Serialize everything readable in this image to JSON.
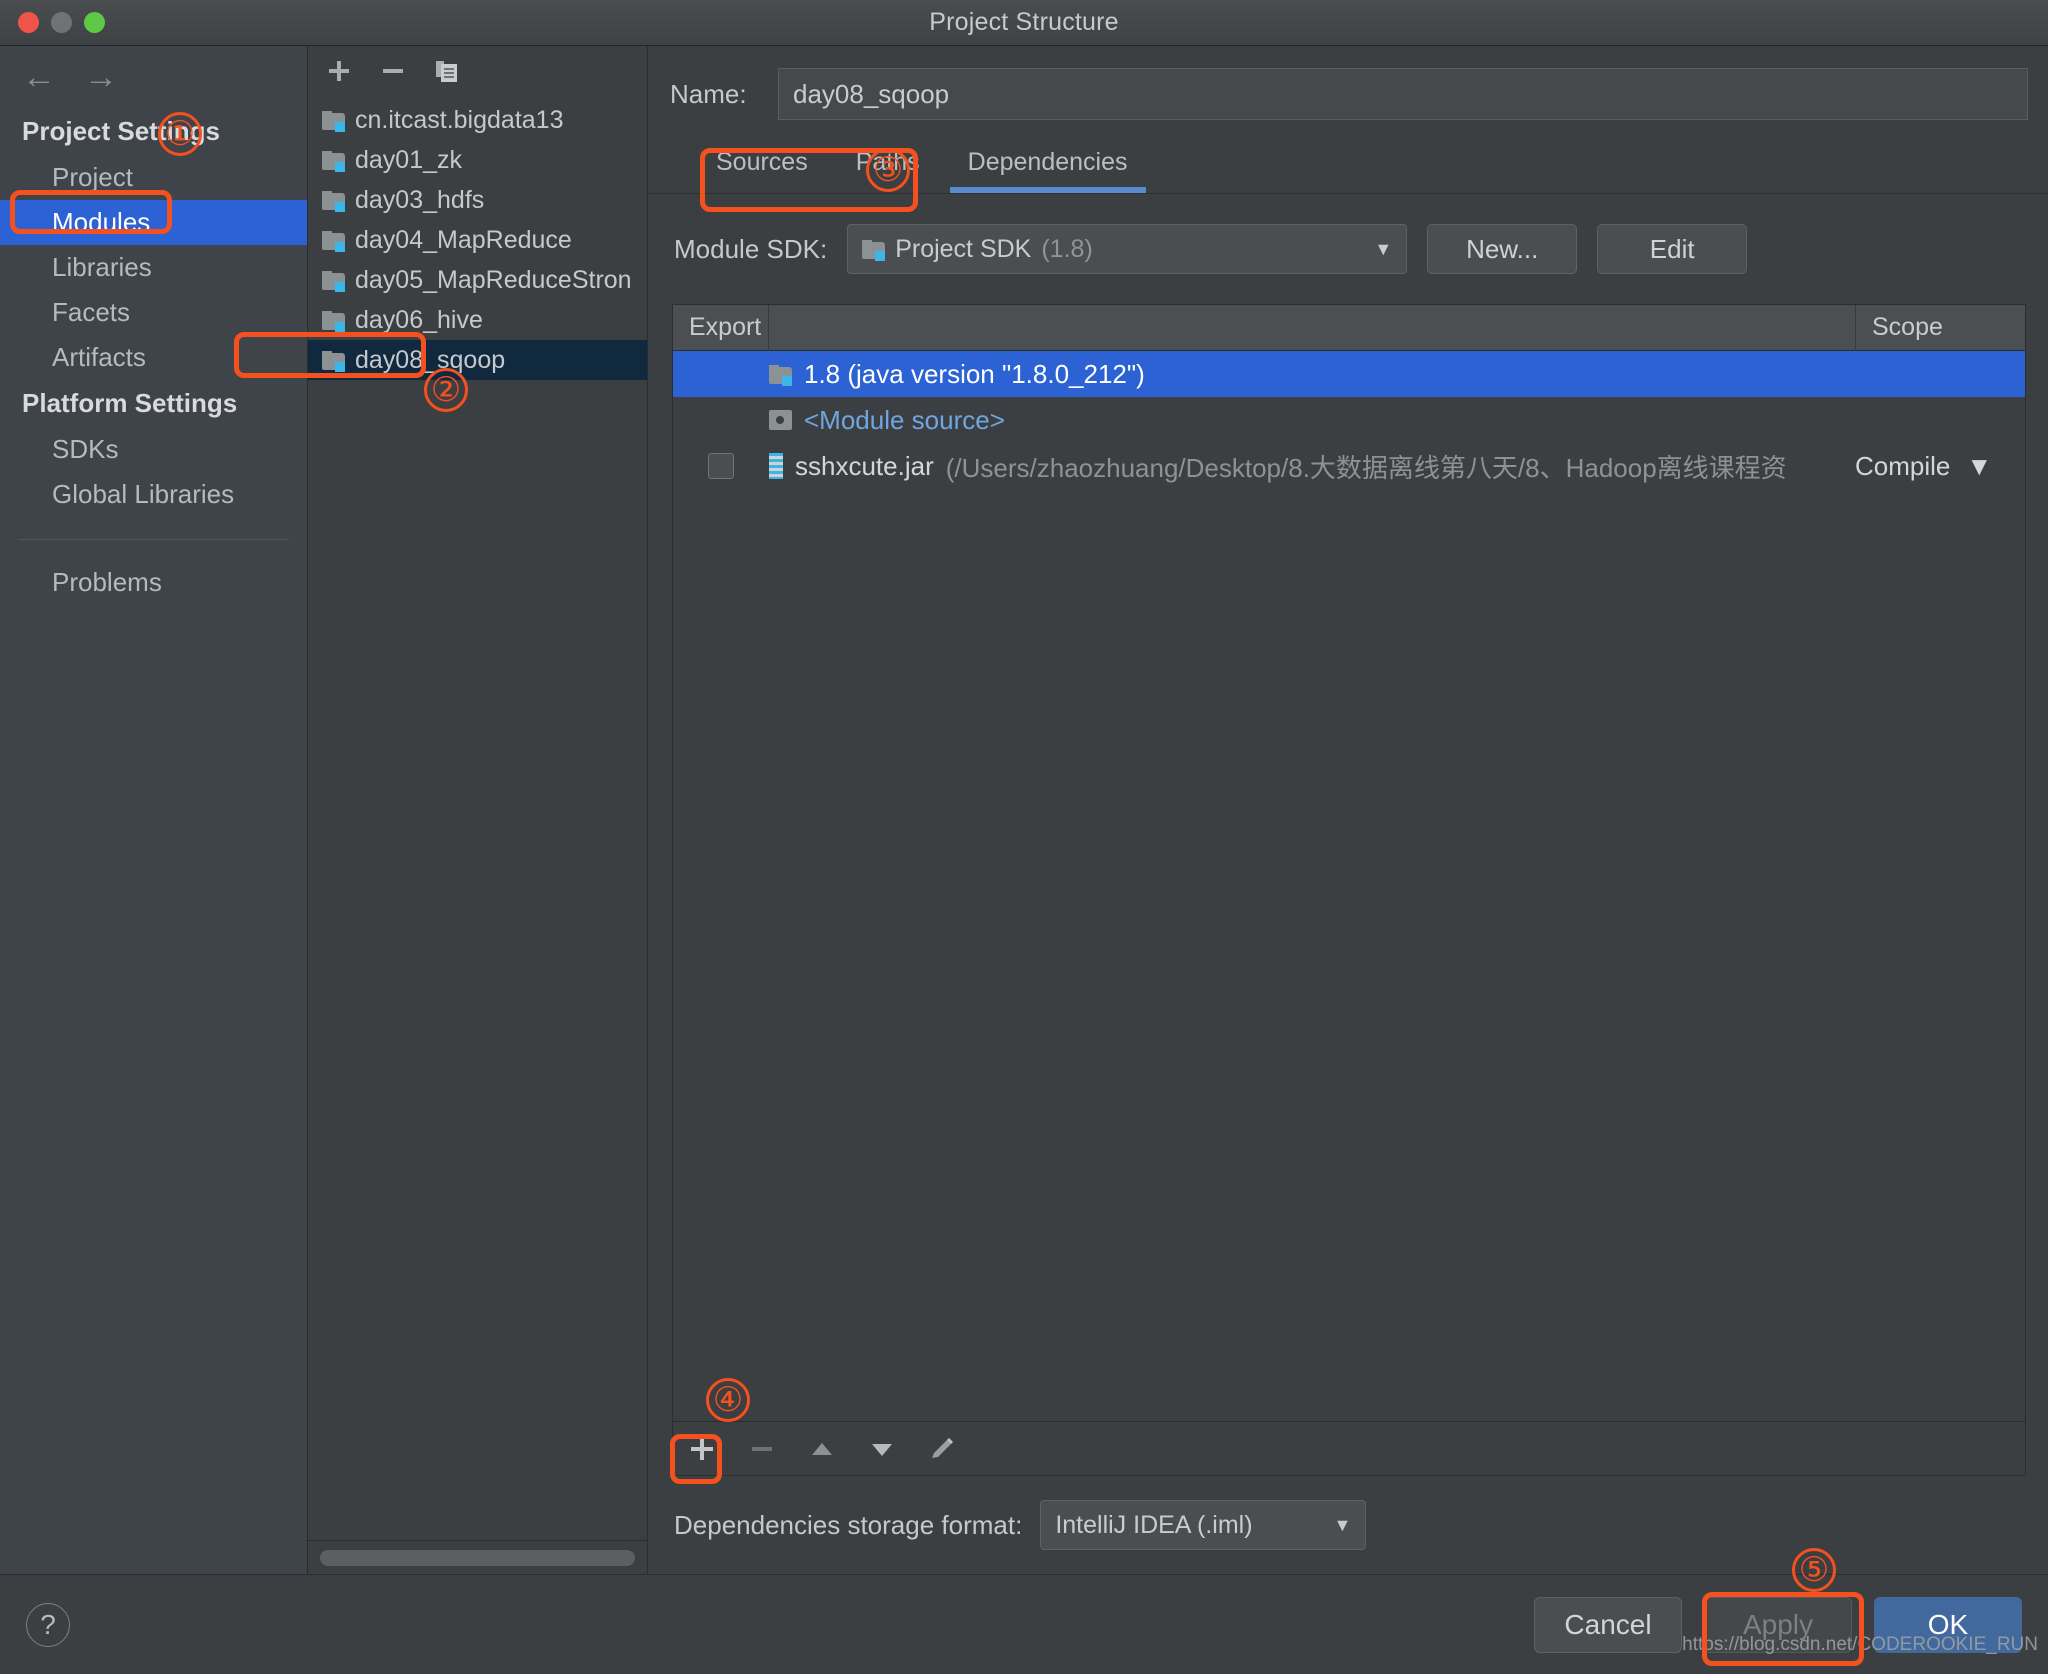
{
  "window": {
    "title": "Project Structure",
    "traffic_lights": [
      "close-icon",
      "minimize-icon",
      "zoom-icon"
    ]
  },
  "sidebar": {
    "nav": {
      "back": "←",
      "forward": "→"
    },
    "sections": [
      {
        "heading": "Project Settings",
        "items": [
          {
            "label": "Project",
            "selected": false
          },
          {
            "label": "Modules",
            "selected": true
          },
          {
            "label": "Libraries",
            "selected": false
          },
          {
            "label": "Facets",
            "selected": false
          },
          {
            "label": "Artifacts",
            "selected": false
          }
        ]
      },
      {
        "heading": "Platform Settings",
        "items": [
          {
            "label": "SDKs",
            "selected": false
          },
          {
            "label": "Global Libraries",
            "selected": false
          }
        ]
      }
    ],
    "problems": {
      "label": "Problems"
    }
  },
  "modules_panel": {
    "toolbar": {
      "add": "+",
      "remove": "−",
      "copy": "copy-icon"
    },
    "items": [
      {
        "label": "cn.itcast.bigdata13",
        "selected": false
      },
      {
        "label": "day01_zk",
        "selected": false
      },
      {
        "label": "day03_hdfs",
        "selected": false
      },
      {
        "label": "day04_MapReduce",
        "selected": false
      },
      {
        "label": "day05_MapReduceStron",
        "selected": false
      },
      {
        "label": "day06_hive",
        "selected": false
      },
      {
        "label": "day08_sqoop",
        "selected": true
      }
    ]
  },
  "main": {
    "name_label": "Name:",
    "name_value": "day08_sqoop",
    "tabs": [
      {
        "label": "Sources",
        "active": false
      },
      {
        "label": "Paths",
        "active": false
      },
      {
        "label": "Dependencies",
        "active": true
      }
    ],
    "sdk": {
      "label": "Module SDK:",
      "value": "Project SDK",
      "value_suffix": "(1.8)",
      "new_button": "New...",
      "edit_button": "Edit"
    },
    "table": {
      "headers": {
        "export": "Export",
        "middle": "",
        "scope": "Scope"
      },
      "rows": [
        {
          "kind": "sdk",
          "checkbox": false,
          "icon": "jdk-folder-icon",
          "name": "1.8 (java version \"1.8.0_212\")",
          "path": "",
          "scope": "",
          "selected": true
        },
        {
          "kind": "module-source",
          "checkbox": false,
          "icon": "module-source-icon",
          "name": "<Module source>",
          "path": "",
          "scope": "",
          "selected": false
        },
        {
          "kind": "jar",
          "checkbox": true,
          "icon": "jar-icon",
          "name": "sshxcute.jar",
          "path": "(/Users/zhaozhuang/Desktop/8.大数据离线第八天/8、Hadoop离线课程资",
          "scope": "Compile",
          "selected": false
        }
      ]
    },
    "table_toolbar": {
      "add": "+",
      "remove": "−",
      "move_up": "▲",
      "move_down": "▼",
      "edit": "pencil-icon"
    },
    "storage": {
      "label": "Dependencies storage format:",
      "value": "IntelliJ IDEA (.iml)"
    }
  },
  "footer": {
    "help": "?",
    "cancel": "Cancel",
    "apply": "Apply",
    "ok": "OK",
    "watermark": "https://blog.csdn.net/CODEROOKIE_RUN"
  },
  "annotations": [
    {
      "num": "①"
    },
    {
      "num": "②"
    },
    {
      "num": "③"
    },
    {
      "num": "④"
    },
    {
      "num": "⑤"
    }
  ],
  "colors": {
    "accent_selection": "#2c62d3",
    "annotation": "#f4511e",
    "link": "#6fa5e0",
    "tab_underline": "#5a8bd0",
    "primary_button": "#41699d"
  }
}
